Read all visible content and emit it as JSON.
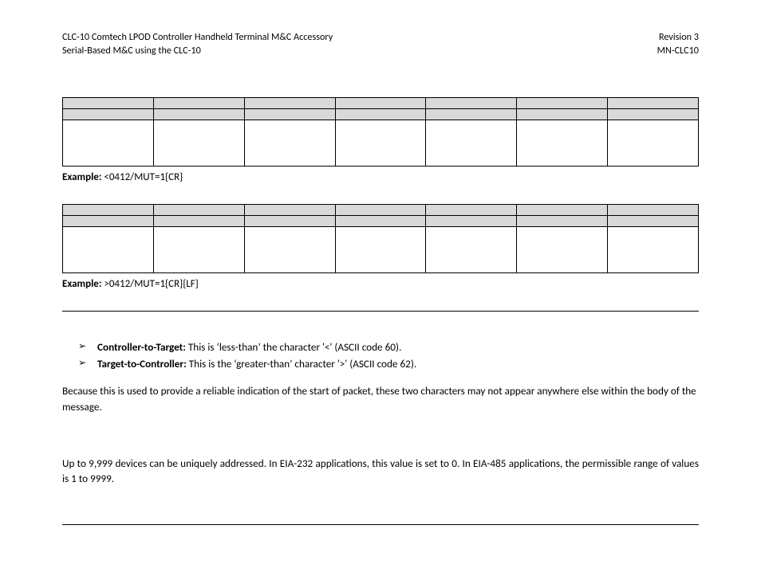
{
  "header": {
    "left_line1": "CLC-10 Comtech LPOD Controller Handheld Terminal M&C Accessory",
    "left_line2": "Serial-Based M&C using the CLC-10",
    "right_line1": "Revision 3",
    "right_line2": "MN-CLC10"
  },
  "table1": {
    "cols": 7,
    "example_label": "Example:",
    "example_text": " <0412/MUT=1{CR}"
  },
  "table2": {
    "cols": 7,
    "example_label": "Example:",
    "example_text": " >0412/MUT=1{CR}{LF}"
  },
  "bullets": {
    "arrow": "➢",
    "item1_label": "Controller-to-Target:",
    "item1_text": " This is ‘less-than’ the character '<' (ASCII code 60).",
    "item2_label": "Target-to-Controller:",
    "item2_text": " This is the ‘greater-than’ character '>' (ASCII code 62)."
  },
  "para1": "Because this is used to provide a reliable indication of the start of packet, these two characters may not appear anywhere else within the body of the message.",
  "para2": "Up to 9,999 devices can be uniquely addressed. In EIA-232 applications, this value is set to 0. In EIA-485 applications, the permissible range of values is 1 to 9999."
}
